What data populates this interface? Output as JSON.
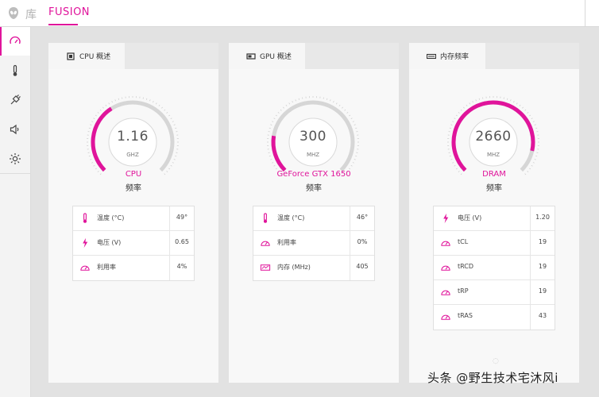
{
  "topbar": {
    "library_label": "库",
    "active_tab": "FUSION"
  },
  "sidebar": {
    "items": [
      {
        "icon": "gauge-icon",
        "active": true
      },
      {
        "icon": "thermometer-icon"
      },
      {
        "icon": "power-plug-icon"
      },
      {
        "icon": "speaker-icon"
      },
      {
        "icon": "brightness-icon"
      }
    ]
  },
  "colors": {
    "accent": "#e0149b",
    "gauge_track": "#d6d6d6"
  },
  "panels": [
    {
      "tab_label": "CPU 概述",
      "tab_icon": "cpu-chip-icon",
      "gauge": {
        "value": "1.16",
        "unit": "GHZ",
        "fill": 0.38
      },
      "device": "CPU",
      "subtitle": "频率",
      "rows": [
        {
          "icon": "thermometer-icon",
          "label": "温度 (°C)",
          "value": "49°"
        },
        {
          "icon": "lightning-icon",
          "label": "电压 (V)",
          "value": "0.65"
        },
        {
          "icon": "gauge-icon",
          "label": "利用率",
          "value": "4%"
        }
      ]
    },
    {
      "tab_label": "GPU 概述",
      "tab_icon": "gpu-card-icon",
      "gauge": {
        "value": "300",
        "unit": "MHZ",
        "fill": 0.2
      },
      "device": "GeForce GTX 1650",
      "subtitle": "频率",
      "rows": [
        {
          "icon": "thermometer-icon",
          "label": "温度 (°C)",
          "value": "46°"
        },
        {
          "icon": "gauge-icon",
          "label": "利用率",
          "value": "0%"
        },
        {
          "icon": "memory-icon",
          "label": "内存 (MHz)",
          "value": "405"
        }
      ]
    },
    {
      "tab_label": "内存频率",
      "tab_icon": "ram-stick-icon",
      "gauge": {
        "value": "2660",
        "unit": "MHZ",
        "fill": 0.88
      },
      "device": "DRAM",
      "subtitle": "频率",
      "rows": [
        {
          "icon": "lightning-icon",
          "label": "电压 (V)",
          "value": "1.20"
        },
        {
          "icon": "gauge-icon",
          "label": "tCL",
          "value": "19"
        },
        {
          "icon": "gauge-icon",
          "label": "tRCD",
          "value": "19"
        },
        {
          "icon": "gauge-icon",
          "label": "tRP",
          "value": "19"
        },
        {
          "icon": "gauge-icon",
          "label": "tRAS",
          "value": "43"
        }
      ]
    }
  ],
  "watermark": {
    "text": "头条 @野生技术宅沐风i"
  }
}
